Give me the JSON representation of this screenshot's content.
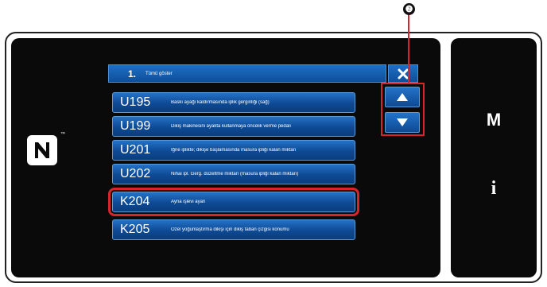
{
  "header": {
    "number": "1.",
    "title": "Tümü göster",
    "close_icon": "close-x-icon"
  },
  "items": [
    {
      "code": "U195",
      "desc": "Baskı ayağı kaldırmasında iplik gerginliği (sağ)"
    },
    {
      "code": "U199",
      "desc": "Dikiş makinesini ayakta kullanmaya öncelik verme pedalı"
    },
    {
      "code": "U201",
      "desc": "İğne iplikte; dikişe başlamasında masura ipliği kalan miktarı"
    },
    {
      "code": "U202",
      "desc": "Nihai ipl. Gerg. düzeltme miktarı (masura ipliği kalan miktarı)"
    },
    {
      "code": "K204",
      "desc": "Ayna işlevi ayarı",
      "selected": true
    },
    {
      "code": "K205",
      "desc": "Özel yoğunlaştırma dikişi için dikiş taban çizgisi konumu"
    }
  ],
  "scroll": {
    "up_icon": "triangle-up-icon",
    "down_icon": "triangle-down-icon"
  },
  "callout": {
    "label": "❷"
  },
  "right_panel": {
    "m_label": "M",
    "info_label": "i"
  },
  "nfc": {
    "icon": "nfc-icon",
    "tm": "™"
  },
  "colors": {
    "button_blue": "#1d6fc4",
    "highlight_red": "#d8242b",
    "panel_black": "#0a0a0a"
  }
}
